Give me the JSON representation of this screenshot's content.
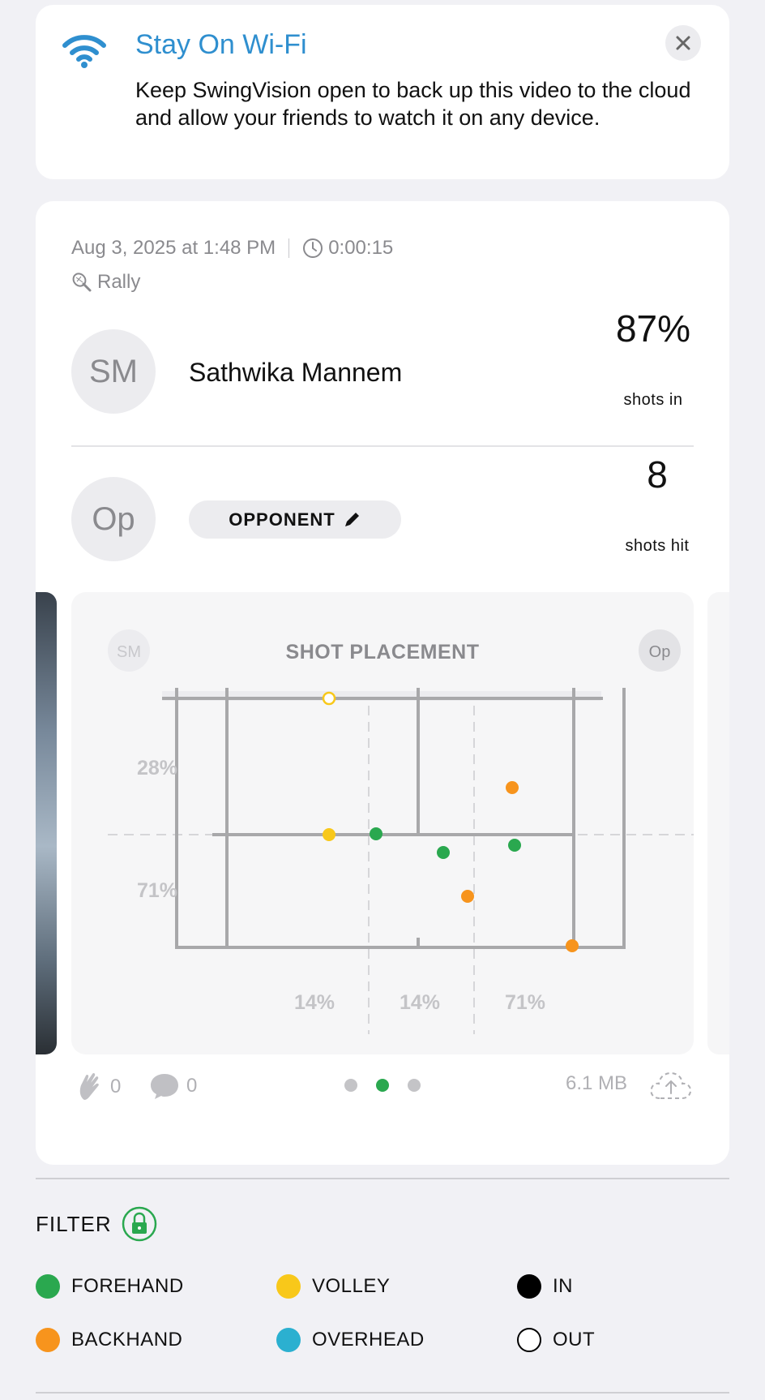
{
  "banner": {
    "title": "Stay On Wi-Fi",
    "text": "Keep SwingVision open to back up this video to the cloud and allow your friends to watch it on any device.",
    "icon": "wifi-icon",
    "close_icon": "close-icon"
  },
  "session": {
    "date": "Aug 3, 2025 at 1:48 PM",
    "duration": "0:00:15",
    "mode": "Rally"
  },
  "player": {
    "initials": "SM",
    "name": "Sathwika Mannem",
    "stat_value": "87%",
    "stat_label": "shots in"
  },
  "opponent": {
    "initials": "Op",
    "button_label": "OPPONENT",
    "stat_value": "8",
    "stat_label": "shots hit"
  },
  "shot_placement": {
    "title": "SHOT PLACEMENT",
    "left_badge": "SM",
    "right_badge": "Op",
    "depth_labels": [
      "28%",
      "71%"
    ],
    "width_labels": [
      "14%",
      "14%",
      "71%"
    ]
  },
  "footer": {
    "claps": "0",
    "comments": "0",
    "file_size": "6.1 MB",
    "pages": 3,
    "active_page": 1
  },
  "filter": {
    "title": "FILTER",
    "items": [
      {
        "label": "FOREHAND",
        "color": "#2aa84f"
      },
      {
        "label": "VOLLEY",
        "color": "#f8c81a"
      },
      {
        "label": "IN",
        "color": "#000000"
      },
      {
        "label": "BACKHAND",
        "color": "#f7941d"
      },
      {
        "label": "OVERHEAD",
        "color": "#2bb0d0"
      },
      {
        "label": "OUT",
        "color": "outline"
      }
    ]
  },
  "colors": {
    "accent_blue": "#2f8fcf",
    "forehand": "#2aa84f",
    "backhand": "#f7941d",
    "volley": "#f8c81a",
    "overhead": "#2bb0d0"
  }
}
